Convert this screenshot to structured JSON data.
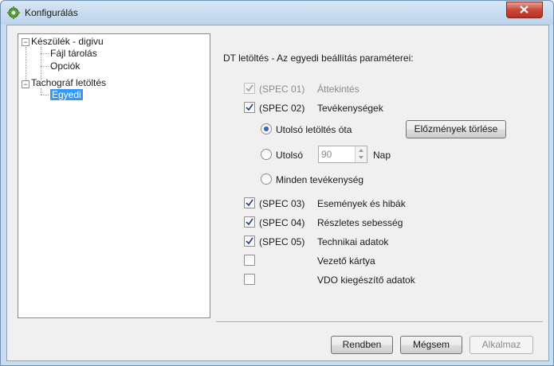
{
  "window": {
    "title": "Konfigurálás"
  },
  "tree": {
    "items": [
      {
        "label": "Készülék - digivu"
      },
      {
        "label": "Fájl tárolás"
      },
      {
        "label": "Opciók"
      },
      {
        "label": "Tachográf letöltés"
      },
      {
        "label": "Egyedi"
      }
    ]
  },
  "panel": {
    "heading": "DT letöltés - Az egyedi beállítás paraméterei:",
    "options": [
      {
        "code": "(SPEC 01)",
        "label": "Áttekintés",
        "checked": true,
        "disabled": true
      },
      {
        "code": "(SPEC 02)",
        "label": "Tevékenységek",
        "checked": true
      },
      {
        "code": "(SPEC 03)",
        "label": "Események és hibák",
        "checked": true
      },
      {
        "code": "(SPEC 04)",
        "label": "Részletes sebesség",
        "checked": true
      },
      {
        "code": "(SPEC 05)",
        "label": "Technikai adatok",
        "checked": true
      },
      {
        "code": "",
        "label": "Vezető kártya",
        "checked": false
      },
      {
        "code": "",
        "label": "VDO kiegészítő adatok",
        "checked": false
      }
    ],
    "radios": [
      {
        "label": "Utolsó letöltés óta",
        "selected": true
      },
      {
        "label": "Utolsó",
        "selected": false
      },
      {
        "label": "Minden tevékenység",
        "selected": false
      }
    ],
    "clear_history_label": "Előzmények törlése",
    "days_value": "90",
    "days_unit": "Nap"
  },
  "buttons": {
    "ok": "Rendben",
    "cancel": "Mégsem",
    "apply": "Alkalmaz"
  }
}
